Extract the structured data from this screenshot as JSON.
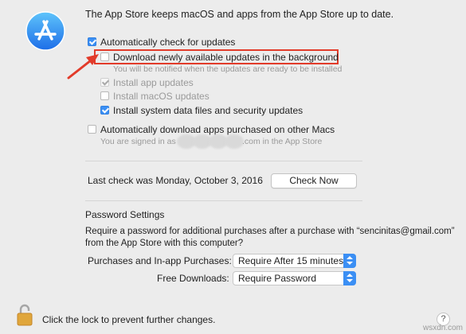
{
  "header": {
    "description": "The App Store keeps macOS and apps from the App Store up to date."
  },
  "updates": {
    "auto_check": "Automatically check for updates",
    "download_bg": "Download newly available updates in the background",
    "download_bg_note": "You will be notified when the updates are ready to be installed",
    "install_app": "Install app updates",
    "install_macos": "Install macOS updates",
    "install_system": "Install system data files and security updates",
    "auto_download": "Automatically download apps purchased on other Macs",
    "signed_in_prefix": "You are signed in as",
    "signed_in_suffix": ".com in the App Store"
  },
  "last_check": {
    "text": "Last check was Monday, October 3, 2016",
    "button": "Check Now"
  },
  "password": {
    "heading": "Password Settings",
    "description_line1": "Require a password for additional purchases after a purchase with “sencinitas@gmail.com”",
    "description_line2": "from the App Store with this computer?",
    "purchases_label": "Purchases and In-app Purchases:",
    "purchases_value": "Require After 15 minutes",
    "free_label": "Free Downloads:",
    "free_value": "Require Password"
  },
  "footer": {
    "lock_text": "Click the lock to prevent further changes.",
    "help": "?"
  },
  "watermark": "wsxdn.com",
  "colors": {
    "accent": "#3b8ff4",
    "highlight": "#e23b2a"
  }
}
